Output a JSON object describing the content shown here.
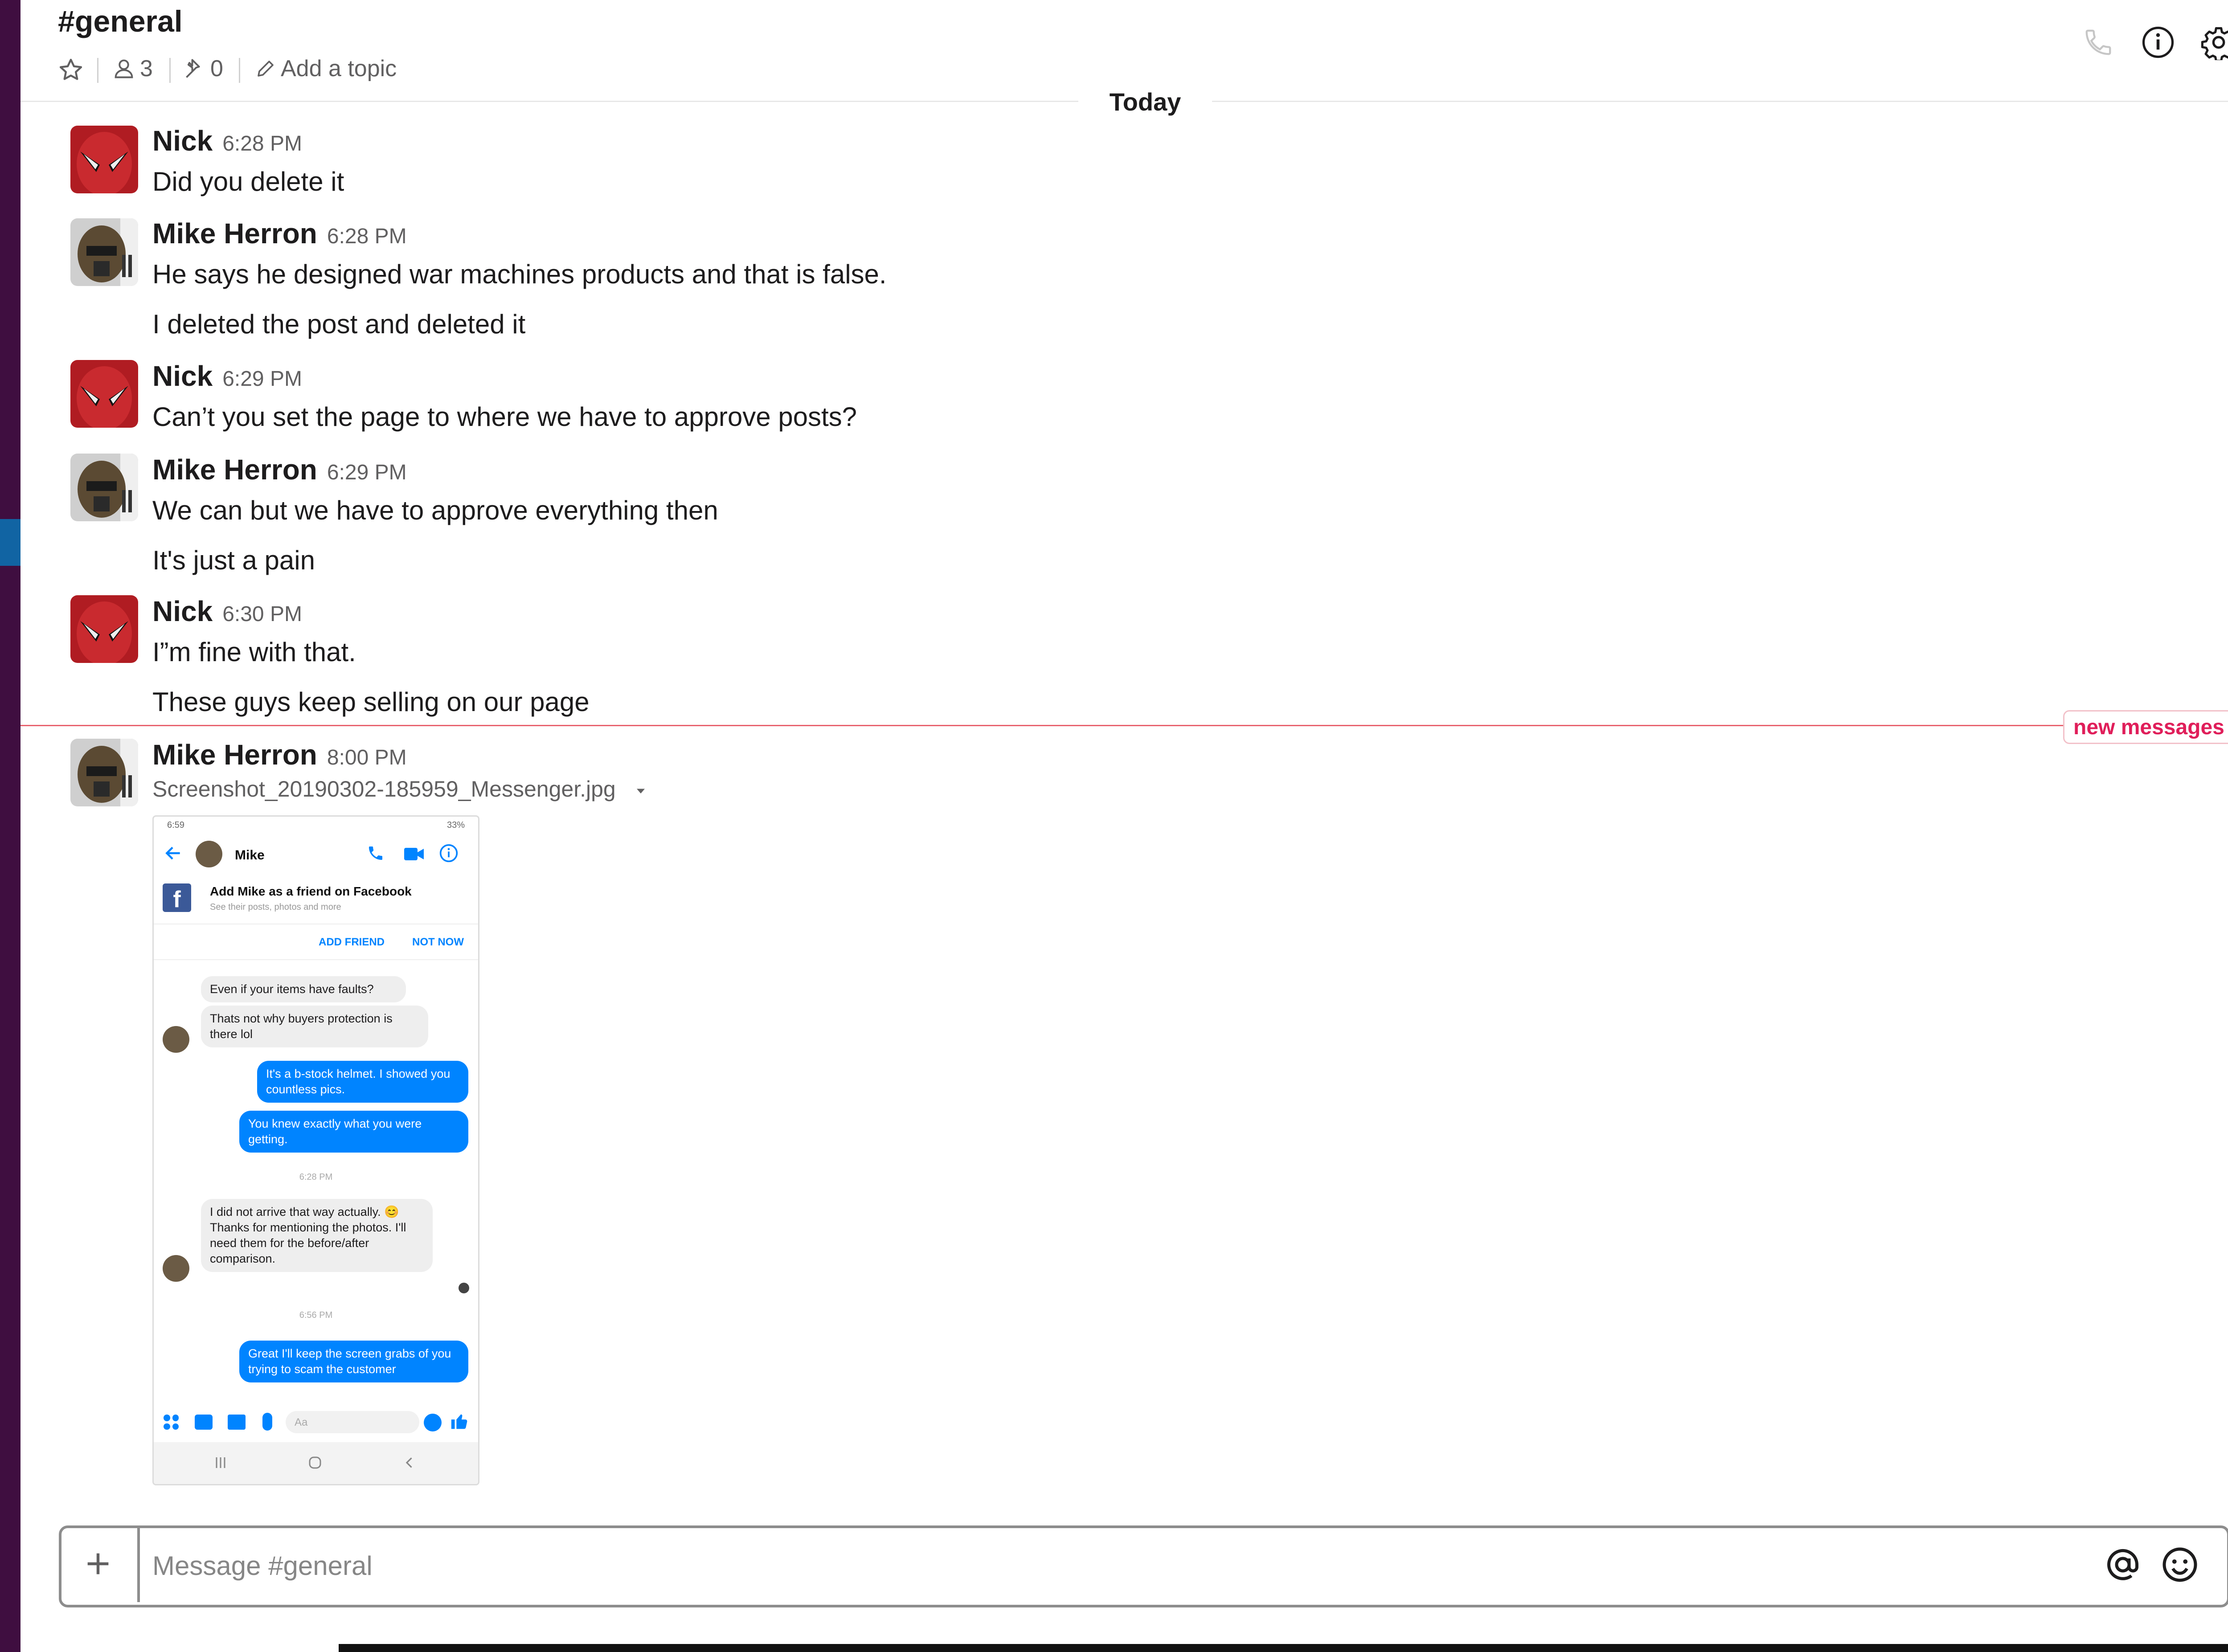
{
  "header": {
    "title": "#general",
    "members_count": "3",
    "pins_count": "0",
    "add_topic": "Add a topic"
  },
  "date_divider": "Today",
  "messages": [
    {
      "sender": "Nick",
      "time": "6:28 PM",
      "lines": [
        "Did you delete it"
      ]
    },
    {
      "sender": "Mike Herron",
      "time": "6:28 PM",
      "lines": [
        "He says he designed war machines products and that is false.",
        "I deleted the post and deleted it"
      ]
    },
    {
      "sender": "Nick",
      "time": "6:29 PM",
      "lines": [
        "Can’t you set the page to where we have to approve posts?"
      ]
    },
    {
      "sender": "Mike Herron",
      "time": "6:29 PM",
      "lines": [
        "We can but we have to approve everything then",
        "It's just a pain"
      ]
    },
    {
      "sender": "Nick",
      "time": "6:30 PM",
      "lines": [
        "I”m fine with that.",
        "These guys keep selling on our page"
      ]
    }
  ],
  "new_messages_label": "new messages",
  "file_message": {
    "sender": "Mike Herron",
    "time": "8:00 PM",
    "file_name": "Screenshot_20190302-185959_Messenger.jpg"
  },
  "screenshot": {
    "status_time": "6:59",
    "status_right": "33%",
    "contact": "Mike",
    "fb_title": "Add Mike as a friend on Facebook",
    "fb_sub": "See their posts, photos and more",
    "add_friend": "ADD FRIEND",
    "not_now": "NOT NOW",
    "b1": "Even if your items have faults?",
    "b2": "Thats not why buyers protection is there lol",
    "b3": "It's a b-stock helmet. I showed you countless pics.",
    "b4": "You knew exactly what you were getting.",
    "t1": "6:28 PM",
    "b5": "I did not arrive that way actually. 😊 Thanks for mentioning the photos. I'll need them for the before/after comparison.",
    "t2": "6:56 PM",
    "b6": "Great I'll keep the screen grabs of you trying to scam the customer",
    "input_placeholder": "Aa"
  },
  "composer": {
    "placeholder": "Message #general"
  },
  "colors": {
    "sidebar": "#3f0e40",
    "sidebar_active": "#1164a3",
    "new_messages": "#e01e5a",
    "messenger_blue": "#0084ff"
  }
}
